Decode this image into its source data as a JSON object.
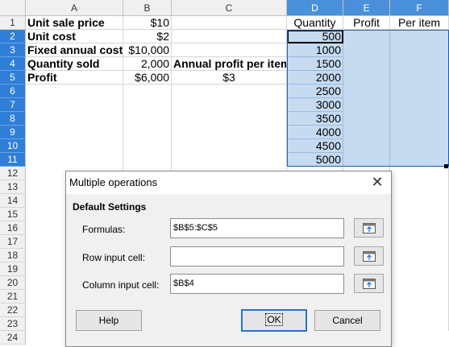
{
  "columns": [
    "A",
    "B",
    "C",
    "D",
    "E",
    "F"
  ],
  "rows": [
    "1",
    "2",
    "3",
    "4",
    "5",
    "6",
    "7",
    "8",
    "9",
    "10",
    "11",
    "12",
    "13",
    "14",
    "15",
    "16",
    "17",
    "18",
    "19",
    "20",
    "21",
    "22",
    "23",
    "24"
  ],
  "cells": {
    "A1": "Unit sale price",
    "B1": "$10",
    "A2": "Unit cost",
    "B2": "$2",
    "A3": "Fixed annual cost",
    "B3": "$10,000",
    "A4": "Quantity sold",
    "B4": "2,000",
    "C4": "Annual profit per item",
    "A5": "Profit",
    "B5": "$6,000",
    "C5": "$3",
    "D1": "Quantity",
    "E1": "Profit",
    "F1": "Per item",
    "D2": "500",
    "D3": "1000",
    "D4": "1500",
    "D5": "2000",
    "D6": "2500",
    "D7": "3000",
    "D8": "3500",
    "D9": "4000",
    "D10": "4500",
    "D11": "5000"
  },
  "dialog": {
    "title": "Multiple operations",
    "section": "Default Settings",
    "formulas_label": "Formulas:",
    "formulas_value": "$B$5:$C$5",
    "row_input_label": "Row input cell:",
    "row_input_value": "",
    "column_input_label": "Column input cell:",
    "column_input_value": "$B$4",
    "help_label": "Help",
    "ok_label": "OK",
    "cancel_label": "Cancel",
    "close_glyph": "✕"
  },
  "colors": {
    "selection_fill": "#c6daf0",
    "header_selected": "#4a90d9",
    "default_button_border": "#2a73c8"
  }
}
